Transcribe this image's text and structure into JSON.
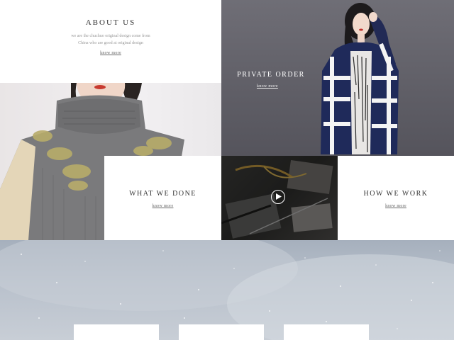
{
  "about": {
    "title": "ABOUT US",
    "desc_line1": "we are the chuchuo original design come from",
    "desc_line2": "China who are good at original design",
    "link": "know more"
  },
  "private_order": {
    "title": "PRIVATE ORDER",
    "link": "know more"
  },
  "what_we_done": {
    "title": "WHAT WE DONE",
    "link": "know more"
  },
  "video": {
    "icon": "play-icon"
  },
  "how_we_work": {
    "title": "HOW WE WORK",
    "link": "know more"
  },
  "colors": {
    "text_dark": "#333333",
    "text_muted": "#999999",
    "private_bg": "#65646c",
    "snow_bg": "#b9c1cc"
  }
}
